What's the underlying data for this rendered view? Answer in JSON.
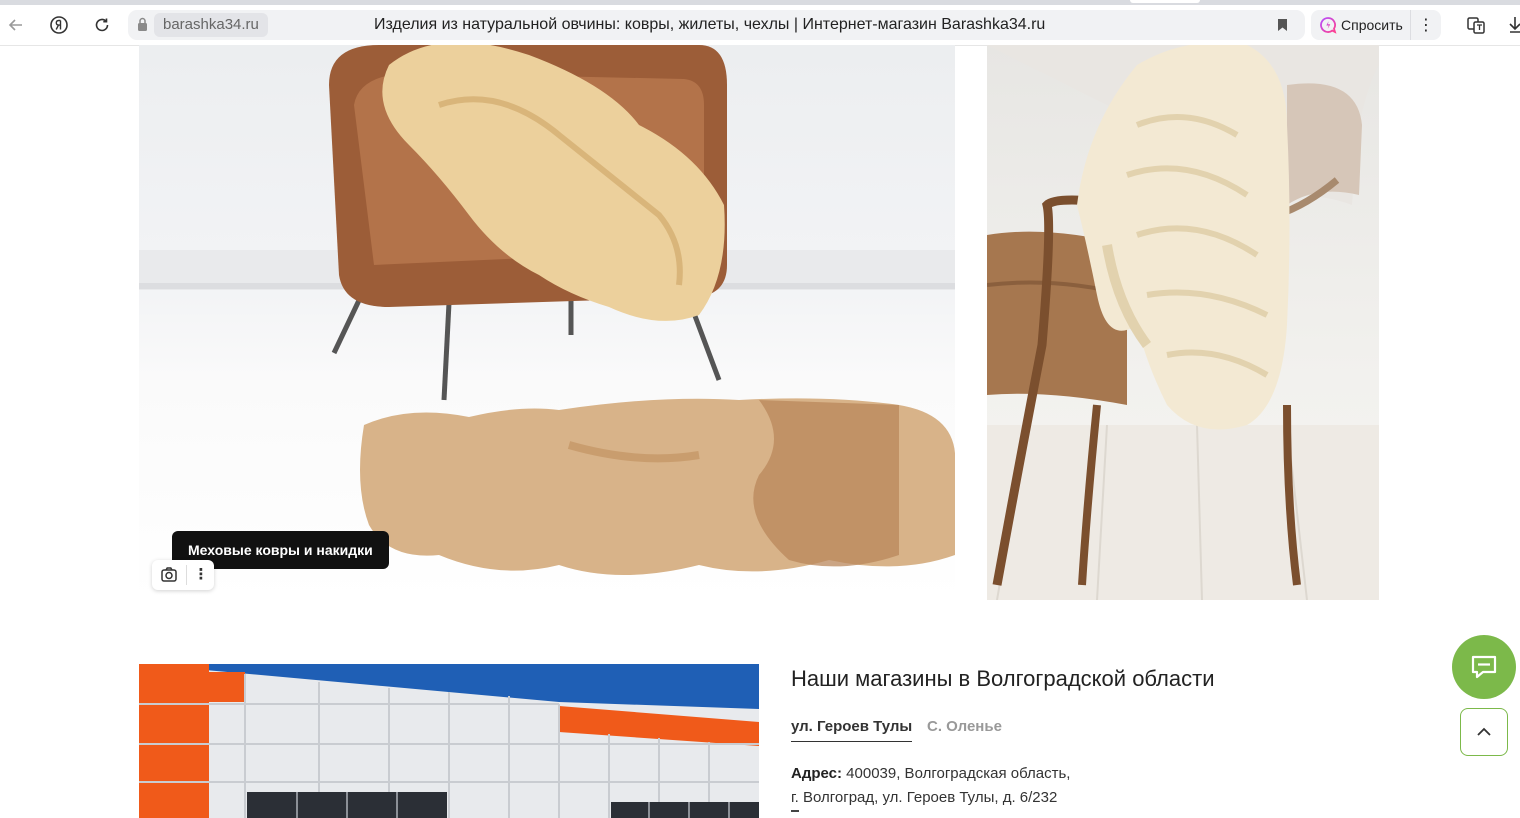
{
  "browser": {
    "domain": "barashka34.ru",
    "page_title": "Изделия из натуральной овчины: ковры, жилеты, чехлы | Интернет-магазин Barashka34.ru",
    "ask_label": "Спросить",
    "more_glyph": "⋮"
  },
  "gallery": {
    "caption": "Меховые ковры и накидки",
    "lens_more_glyph": "⋮"
  },
  "stores": {
    "title": "Наши магазины в Волгоградской области",
    "tabs": [
      {
        "label": "ул. Героев Тулы",
        "active": true
      },
      {
        "label": "С. Оленье",
        "active": false
      }
    ],
    "address_label": "Адрес:",
    "address_line1": "400039, Волгоградская область,",
    "address_line2": "г. Волгоград, ул. Героев Тулы, д. 6/232"
  },
  "colors": {
    "accent": "#7cb94a",
    "store_facade_orange": "#f05a1a",
    "sky": "#1f5fb5"
  }
}
